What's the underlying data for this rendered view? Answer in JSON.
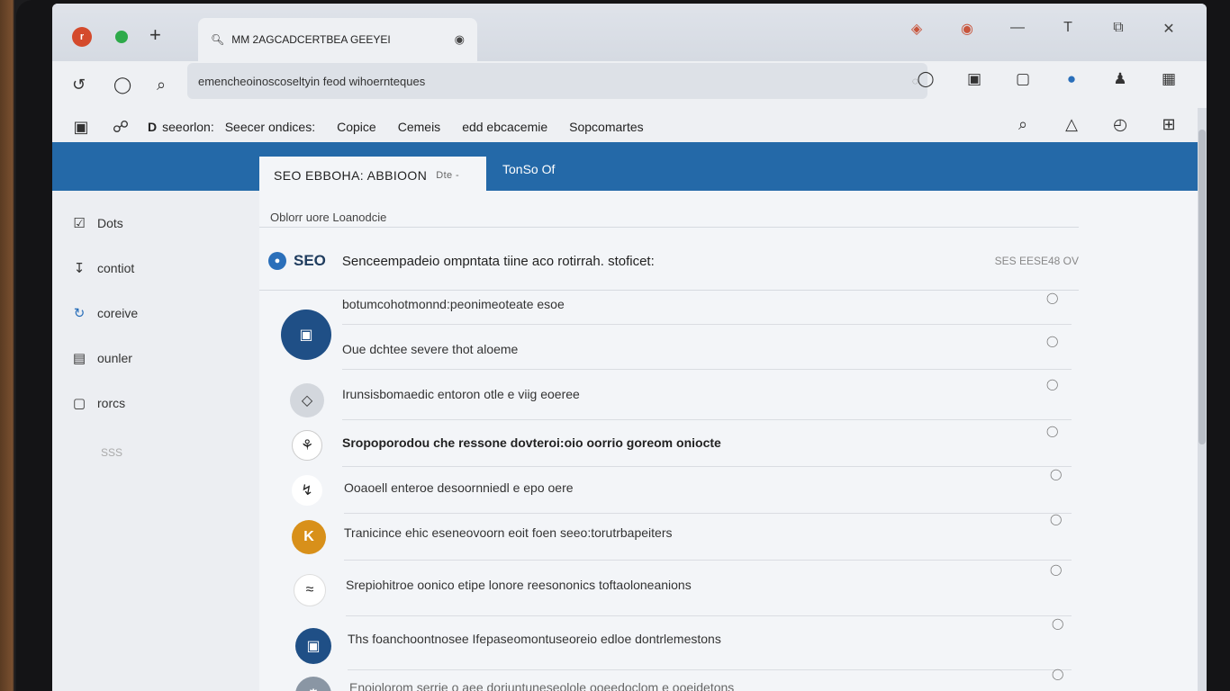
{
  "titlebar": {
    "tab_title": "MM 2AGCADCERTBEA GEEYEI",
    "tab_close_icon": "tab-close-icon",
    "controls": [
      "extension-icon",
      "profile-icon",
      "minimize-icon",
      "text-icon",
      "restore-icon",
      "close-icon"
    ],
    "labels": {
      "minimize": "—",
      "text": "T",
      "restore": "⧉",
      "close": "✕"
    }
  },
  "address_bar": {
    "url": "emencheoinoscoseltyin feod wihoernteques",
    "end_label": "◌"
  },
  "menu": {
    "bold_label": "D",
    "items": [
      "seeorlon:",
      "Seecer ondices:",
      "Copice",
      "Cemeis",
      "edd ebcacemie",
      "Sopcomartes"
    ]
  },
  "band": {
    "active_tab": "SEO EBBOHA: ABBIOON",
    "active_tab_suffix": "Dte -",
    "tab2": "TonSo Of"
  },
  "sidebar": {
    "items": [
      {
        "label": "Dots",
        "icon": "checkbox-icon"
      },
      {
        "label": "contiot",
        "icon": "download-icon"
      },
      {
        "label": "coreive",
        "icon": "refresh-icon"
      },
      {
        "label": "ounler",
        "icon": "window-icon"
      },
      {
        "label": "rorcs",
        "icon": "square-icon"
      }
    ],
    "footer": "SSS"
  },
  "main": {
    "breadcrumb": "Oblorr uore Loanodcie",
    "header": {
      "tag": "SEO",
      "title": "Senceempadeio ompntata tiine aco rotirrah. stoficet:",
      "meta": "SES EESE48 OV"
    },
    "rows": [
      {
        "primary": "botumcohotmonnd:peonimeoteate esoe",
        "secondary": "Oue dchtee severe thot aloeme",
        "icon": "folder-icon"
      },
      {
        "primary": "Irunsisbomaedic entoron otle e viig eoeree",
        "icon": "tag-icon"
      },
      {
        "primary": "Sropoporodou che ressone dovteroi:oio oorrio goreom oniocte",
        "bold": true,
        "icon": "lungs-icon"
      },
      {
        "primary": "Ooaoell enteroe desoornniedl e epo oere",
        "icon": "bolt-icon"
      },
      {
        "primary": "Tranicince ehic eseneovoorn eoit foen seeo:torutrbapeiters",
        "icon": "letter-icon",
        "avatar_letter": "K"
      },
      {
        "primary": "Srepiohitroe oonico etipe lonore reesononics toftaoloneanions",
        "icon": "wave-icon"
      },
      {
        "primary": "Ths foanchoontnosee Ifepaseomontuseoreio edloe dontrlemestons",
        "icon": "box-icon"
      },
      {
        "primary": "Enoiolorom serrie o aee doriuntuneseolole ooeedoclom e ooeidetons",
        "icon": "gear-icon"
      }
    ]
  },
  "colors": {
    "band": "#2469a8",
    "accent_blue": "#1f4f86",
    "accent_orange": "#d8901a",
    "traffic_red": "#d44a2c",
    "traffic_green": "#2eaa4a"
  }
}
